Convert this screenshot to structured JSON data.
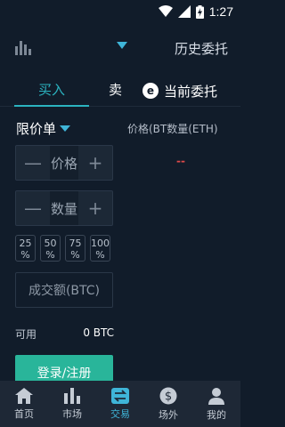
{
  "status": {
    "time": "1:27"
  },
  "header": {
    "history_label": "历史委托"
  },
  "tabs": {
    "buy": "买入",
    "sell": "卖",
    "current_orders": "当前委托",
    "orders_badge": "e"
  },
  "order": {
    "type_label": "限价单",
    "price_placeholder": "价格",
    "amount_placeholder": "数量",
    "minus": "—",
    "plus": "+",
    "percents": [
      {
        "top": "25",
        "bottom": "%"
      },
      {
        "top": "50",
        "bottom": "%"
      },
      {
        "top": "75",
        "bottom": "%"
      },
      {
        "top": "100",
        "bottom": "%"
      }
    ],
    "volume_label": "成交额(BTC)",
    "available_label": "可用",
    "available_value": "0 BTC",
    "login_label": "登录/注册"
  },
  "orderbook": {
    "header": "价格(BT数量(ETH)",
    "empty_marker": "--"
  },
  "nav": [
    {
      "label": "首页",
      "icon": "home-icon"
    },
    {
      "label": "市场",
      "icon": "bar-chart-icon"
    },
    {
      "label": "交易",
      "icon": "swap-icon",
      "active": true
    },
    {
      "label": "场外",
      "icon": "dollar-icon"
    },
    {
      "label": "我的",
      "icon": "user-icon"
    }
  ],
  "colors": {
    "accent": "#2bb3c0",
    "login": "#29b59a",
    "sell_red": "#e04a4a",
    "background": "#111c2a"
  }
}
